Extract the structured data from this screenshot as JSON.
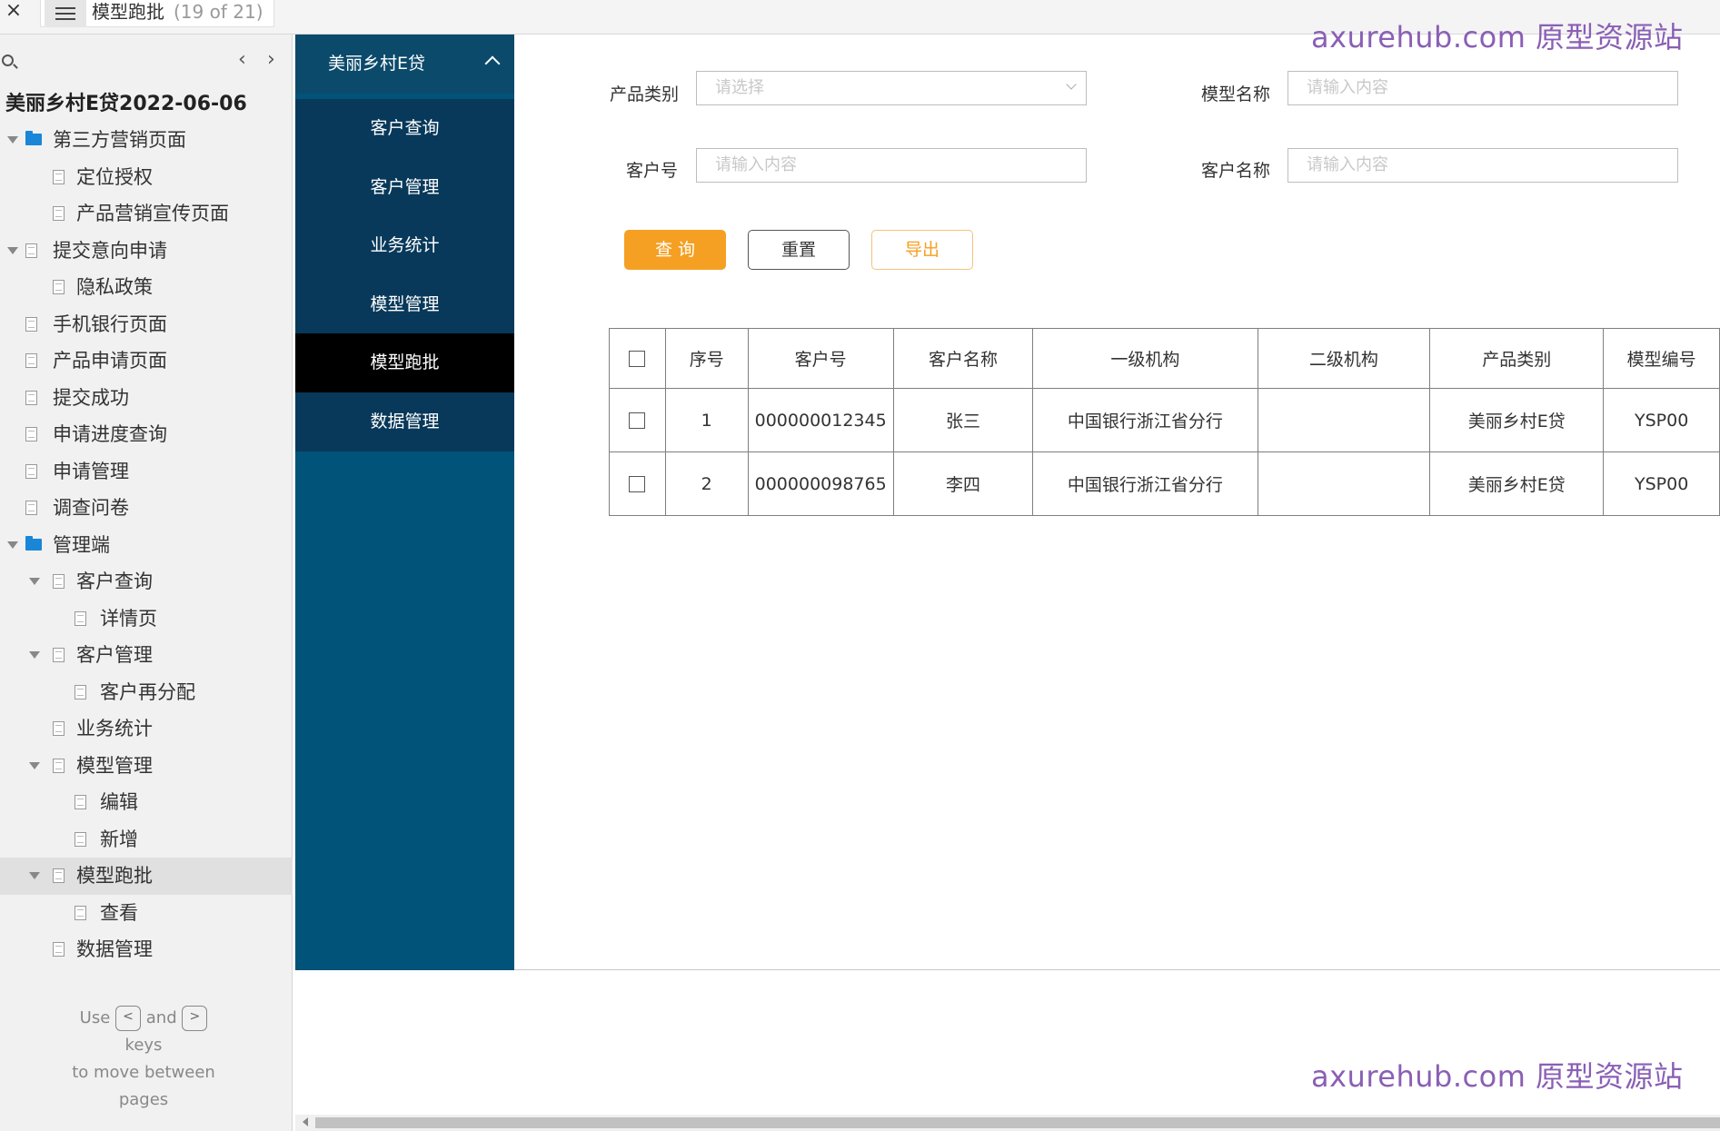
{
  "topbar": {
    "close": "×",
    "title": "模型跑批",
    "counter": "(19 of 21)"
  },
  "leftpanel": {
    "prev": "‹",
    "next": "›",
    "project_title": "美丽乡村E贷2022-06-06",
    "tree": [
      {
        "label": "第三方营销页面",
        "level": 0,
        "type": "folder",
        "expanded": true
      },
      {
        "label": "定位授权",
        "level": 1,
        "type": "page"
      },
      {
        "label": "产品营销宣传页面",
        "level": 1,
        "type": "page"
      },
      {
        "label": "提交意向申请",
        "level": 0,
        "type": "page",
        "expanded": true
      },
      {
        "label": "隐私政策",
        "level": 1,
        "type": "page"
      },
      {
        "label": "手机银行页面",
        "level": 0,
        "type": "page"
      },
      {
        "label": "产品申请页面",
        "level": 0,
        "type": "page"
      },
      {
        "label": "提交成功",
        "level": 0,
        "type": "page"
      },
      {
        "label": "申请进度查询",
        "level": 0,
        "type": "page"
      },
      {
        "label": "申请管理",
        "level": 0,
        "type": "page"
      },
      {
        "label": "调查问卷",
        "level": 0,
        "type": "page"
      },
      {
        "label": "管理端",
        "level": 0,
        "type": "folder",
        "expanded": true
      },
      {
        "label": "客户查询",
        "level": 1,
        "type": "page",
        "expanded": true
      },
      {
        "label": "详情页",
        "level": 2,
        "type": "page"
      },
      {
        "label": "客户管理",
        "level": 1,
        "type": "page",
        "expanded": true
      },
      {
        "label": "客户再分配",
        "level": 2,
        "type": "page"
      },
      {
        "label": "业务统计",
        "level": 1,
        "type": "page"
      },
      {
        "label": "模型管理",
        "level": 1,
        "type": "page",
        "expanded": true
      },
      {
        "label": "编辑",
        "level": 2,
        "type": "page"
      },
      {
        "label": "新增",
        "level": 2,
        "type": "page"
      },
      {
        "label": "模型跑批",
        "level": 1,
        "type": "page",
        "expanded": true,
        "selected": true
      },
      {
        "label": "查看",
        "level": 2,
        "type": "page"
      },
      {
        "label": "数据管理",
        "level": 1,
        "type": "page"
      }
    ],
    "help": {
      "use": "Use",
      "key_prev": "<",
      "and": "and",
      "key_next": ">",
      "keys": "keys",
      "to_move": "to move between",
      "pages": "pages"
    }
  },
  "proto": {
    "sidenav": {
      "header": "美丽乡村E贷",
      "items": [
        "客户查询",
        "客户管理",
        "业务统计",
        "模型管理",
        "模型跑批",
        "数据管理"
      ],
      "active_index": 4
    },
    "form": {
      "product_type_label": "产品类别",
      "product_type_placeholder": "请选择",
      "model_name_label": "模型名称",
      "model_name_placeholder": "请输入内容",
      "customer_no_label": "客户号",
      "customer_no_placeholder": "请输入内容",
      "customer_name_label": "客户名称",
      "customer_name_placeholder": "请输入内容"
    },
    "buttons": {
      "query": "查 询",
      "reset": "重置",
      "export": "导出"
    },
    "table": {
      "headers": [
        "序号",
        "客户号",
        "客户名称",
        "一级机构",
        "二级机构",
        "产品类别",
        "模型编号"
      ],
      "rows": [
        [
          "1",
          "000000012345",
          "张三",
          "中国银行浙江省分行",
          "",
          "美丽乡村E贷",
          "YSP00"
        ],
        [
          "2",
          "000000098765",
          "李四",
          "中国银行浙江省分行",
          "",
          "美丽乡村E贷",
          "YSP00"
        ]
      ]
    }
  },
  "watermarks": {
    "top": "axurehub.com 原型资源站",
    "bottom": "axurehub.com 原型资源站"
  },
  "colors": {
    "sidenav_bg": "#015379",
    "sidenav_item_bg": "#08395a",
    "active_item_bg": "#000000",
    "accent_orange": "#f5a023",
    "folder_blue": "#1a86d8",
    "watermark": "#8a5fb5"
  }
}
